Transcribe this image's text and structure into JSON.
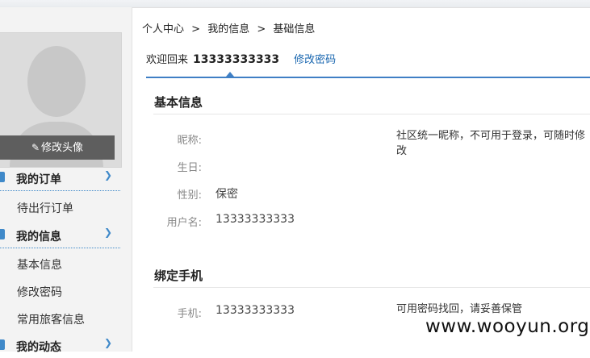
{
  "breadcrumb": [
    "个人中心",
    ">",
    "我的信息",
    ">",
    "基础信息"
  ],
  "welcome": {
    "text": "欢迎回来",
    "phone": "13333333333",
    "change_password": "修改密码"
  },
  "sidebar": {
    "avatar_edit": "修改头像",
    "sections": [
      {
        "title": "我的订单",
        "items": [
          "待出行订单"
        ]
      },
      {
        "title": "我的信息",
        "items": [
          "基本信息",
          "修改密码",
          "常用旅客信息"
        ]
      },
      {
        "title": "我的动态",
        "items": []
      }
    ]
  },
  "basic_info": {
    "title": "基本信息",
    "nickname_label": "昵称:",
    "nickname_note": "社区统一昵称，不可用于登录，可随时修改",
    "birthday_label": "生日:",
    "gender_label": "性别:",
    "gender_value": "保密",
    "username_label": "用户名:",
    "username_value": "13333333333"
  },
  "bind_phone": {
    "title": "绑定手机",
    "phone_label": "手机:",
    "phone_value": "13333333333",
    "phone_note": "可用密码找回，请妥善保管"
  },
  "watermark": "www.wooyun.org",
  "colors": {
    "accent": "#3f7fc5",
    "link": "#1a67b0"
  },
  "icons": {
    "chevron": "chevron-right-icon",
    "pen": "pencil-icon"
  }
}
